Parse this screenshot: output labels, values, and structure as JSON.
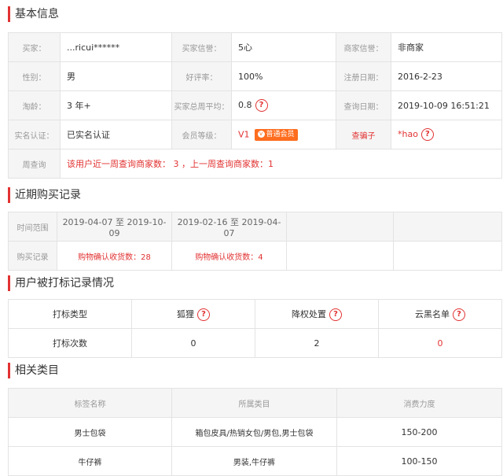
{
  "basic": {
    "title": "基本信息",
    "rows": [
      [
        {
          "l": "买家：",
          "v": "...ricui******"
        },
        {
          "l": "买家信誉：",
          "v": "5心"
        },
        {
          "l": "商家信誉：",
          "v": "非商家"
        }
      ],
      [
        {
          "l": "性别：",
          "v": "男"
        },
        {
          "l": "好评率：",
          "v": "100%"
        },
        {
          "l": "注册日期：",
          "v": "2016-2-23"
        }
      ],
      [
        {
          "l": "淘龄：",
          "v": "3 年+"
        },
        {
          "l": "买家总周平均：",
          "v": "0.8"
        },
        {
          "l": "查询日期：",
          "v": "2019-10-09 16:51:21"
        }
      ],
      [
        {
          "l": "实名认证：",
          "v": "已实名认证"
        },
        {
          "l": "会员等级：",
          "v": "V1"
        },
        {
          "l": "查骗子",
          "v": "*hao"
        }
      ]
    ],
    "member_badge": "普通会员",
    "badge_icon": "v",
    "week_label": "周查询",
    "week_text": "该用户近一周查询商家数： 3 ，上一周查询商家数：1",
    "help_glyph": "?"
  },
  "purchase": {
    "title": "近期购买记录",
    "range_label": "时间范围",
    "record_label": "购买记录",
    "ranges": [
      "2019-04-07 至 2019-10-09",
      "2019-02-16 至 2019-04-07"
    ],
    "records": [
      "购物确认收货数：28",
      "购物确认收货数：4"
    ]
  },
  "marks": {
    "title": "用户被打标记录情况",
    "headers": [
      "打标类型",
      "狐狸",
      "降权处置",
      "云黑名单"
    ],
    "row_label": "打标次数",
    "counts": [
      "0",
      "2",
      "0"
    ]
  },
  "categories": {
    "title": "相关类目",
    "headers": [
      "标签名称",
      "所属类目",
      "消费力度"
    ],
    "rows": [
      [
        "男士包袋",
        "箱包皮具/热销女包/男包,男士包袋",
        "150-200"
      ],
      [
        "牛仔裤",
        "男装,牛仔裤",
        "100-150"
      ]
    ]
  }
}
